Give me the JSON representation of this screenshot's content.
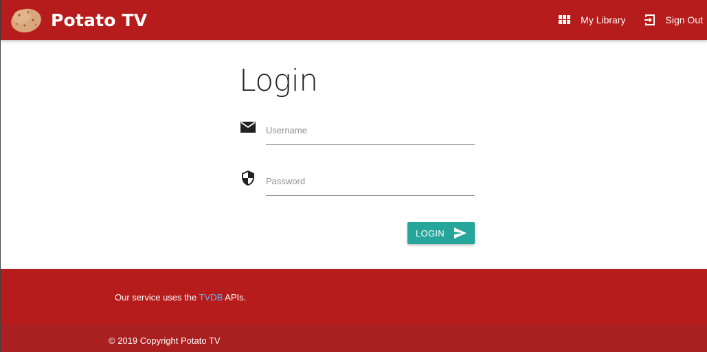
{
  "header": {
    "brand": "Potato TV",
    "nav": [
      {
        "label": "My Library",
        "icon": "view-module-icon"
      },
      {
        "label": "Sign Out",
        "icon": "exit-to-app-icon"
      }
    ]
  },
  "login": {
    "title": "Login",
    "username": {
      "placeholder": "Username",
      "value": "",
      "icon": "email-icon"
    },
    "password": {
      "placeholder": "Password",
      "value": "",
      "icon": "security-shield-icon"
    },
    "submit_label": "LOGIN",
    "submit_icon": "send-icon"
  },
  "footer": {
    "text_before": "Our service uses the ",
    "link_text": "TVDB",
    "text_after": " APIs.",
    "copyright": "© 2019 Copyright Potato TV"
  },
  "colors": {
    "primary": "#b71c1c",
    "footer_copyright_bg": "#aa1f1f",
    "accent": "#26a69a",
    "link": "#64b5f6"
  }
}
